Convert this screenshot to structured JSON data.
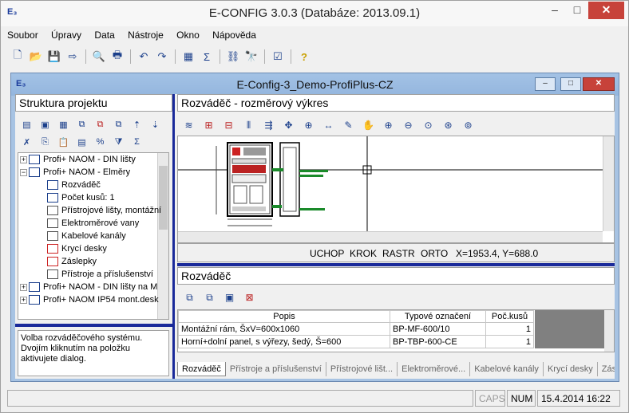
{
  "app": {
    "title": "E-CONFIG 3.0.3  (Databáze: 2013.09.1)",
    "icon": "app-icon"
  },
  "menu": [
    "Soubor",
    "Úpravy",
    "Data",
    "Nástroje",
    "Okno",
    "Nápověda"
  ],
  "window_buttons": {
    "minimize": "–",
    "maximize": "□",
    "close": "✕"
  },
  "mdi": {
    "title": "E-Config-3_Demo-ProfiPlus-CZ"
  },
  "left": {
    "header": "Struktura projektu",
    "tree": [
      {
        "label": "Profi+ NAOM - DIN lišty",
        "level": 0,
        "exp": "+"
      },
      {
        "label": "Profi+ NAOM - Elměry",
        "level": 0,
        "exp": "−"
      },
      {
        "label": "Rozváděč",
        "level": 1
      },
      {
        "label": "Počet kusů: 1",
        "level": 1
      },
      {
        "label": "Přístrojové lišty, montážní",
        "level": 1
      },
      {
        "label": "Elektroměrové vany",
        "level": 1
      },
      {
        "label": "Kabelové kanály",
        "level": 1
      },
      {
        "label": "Krycí desky",
        "level": 1
      },
      {
        "label": "Záslepky",
        "level": 1
      },
      {
        "label": "Přístroje a příslušenství",
        "level": 1
      },
      {
        "label": "Profi+ NAOM - DIN lišty na M",
        "level": 0,
        "exp": "+"
      },
      {
        "label": "Profi+ NAOM IP54 mont.desk",
        "level": 0,
        "exp": "+"
      }
    ],
    "hint": "Volba rozváděčového systému. Dvojím kliknutím na položku aktivujete dialog."
  },
  "drawing": {
    "header": "Rozváděč - rozměrový výkres",
    "status": {
      "uchop": "UCHOP",
      "krok": "KROK",
      "rastr": "RASTR",
      "orto": "ORTO",
      "coords": "X=1953.4, Y=688.0"
    }
  },
  "parts": {
    "header": "Rozváděč",
    "columns": [
      "Popis",
      "Typové označení",
      "Poč.kusů"
    ],
    "rows": [
      [
        "Montážní rám, ŠxV=600x1060",
        "BP-MF-600/10",
        "1"
      ],
      [
        "Horní+dolní panel, s výřezy, šedý, Š=600",
        "BP-TBP-600-CE",
        "1"
      ]
    ],
    "tabs": [
      "Rozváděč",
      "Přístroje a příslušenství",
      "Přístrojové lišt...",
      "Elektroměrové...",
      "Kabelové kanály",
      "Krycí desky",
      "Záslepky"
    ]
  },
  "statusbar": {
    "caps": "CAPS",
    "num": "NUM",
    "datetime": "15.4.2014 16:22"
  }
}
